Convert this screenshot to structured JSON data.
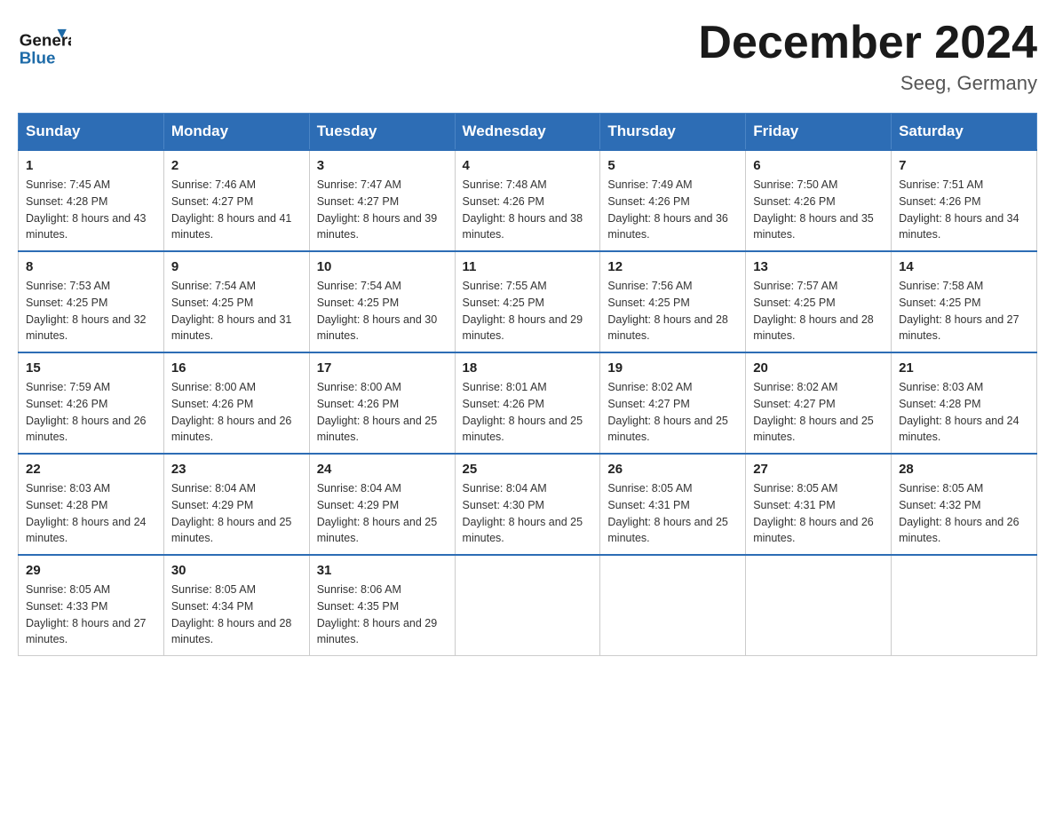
{
  "header": {
    "logo_general": "General",
    "logo_blue": "Blue",
    "title": "December 2024",
    "location": "Seeg, Germany"
  },
  "calendar": {
    "days_of_week": [
      "Sunday",
      "Monday",
      "Tuesday",
      "Wednesday",
      "Thursday",
      "Friday",
      "Saturday"
    ],
    "weeks": [
      [
        {
          "day": "1",
          "sunrise": "7:45 AM",
          "sunset": "4:28 PM",
          "daylight": "8 hours and 43 minutes."
        },
        {
          "day": "2",
          "sunrise": "7:46 AM",
          "sunset": "4:27 PM",
          "daylight": "8 hours and 41 minutes."
        },
        {
          "day": "3",
          "sunrise": "7:47 AM",
          "sunset": "4:27 PM",
          "daylight": "8 hours and 39 minutes."
        },
        {
          "day": "4",
          "sunrise": "7:48 AM",
          "sunset": "4:26 PM",
          "daylight": "8 hours and 38 minutes."
        },
        {
          "day": "5",
          "sunrise": "7:49 AM",
          "sunset": "4:26 PM",
          "daylight": "8 hours and 36 minutes."
        },
        {
          "day": "6",
          "sunrise": "7:50 AM",
          "sunset": "4:26 PM",
          "daylight": "8 hours and 35 minutes."
        },
        {
          "day": "7",
          "sunrise": "7:51 AM",
          "sunset": "4:26 PM",
          "daylight": "8 hours and 34 minutes."
        }
      ],
      [
        {
          "day": "8",
          "sunrise": "7:53 AM",
          "sunset": "4:25 PM",
          "daylight": "8 hours and 32 minutes."
        },
        {
          "day": "9",
          "sunrise": "7:54 AM",
          "sunset": "4:25 PM",
          "daylight": "8 hours and 31 minutes."
        },
        {
          "day": "10",
          "sunrise": "7:54 AM",
          "sunset": "4:25 PM",
          "daylight": "8 hours and 30 minutes."
        },
        {
          "day": "11",
          "sunrise": "7:55 AM",
          "sunset": "4:25 PM",
          "daylight": "8 hours and 29 minutes."
        },
        {
          "day": "12",
          "sunrise": "7:56 AM",
          "sunset": "4:25 PM",
          "daylight": "8 hours and 28 minutes."
        },
        {
          "day": "13",
          "sunrise": "7:57 AM",
          "sunset": "4:25 PM",
          "daylight": "8 hours and 28 minutes."
        },
        {
          "day": "14",
          "sunrise": "7:58 AM",
          "sunset": "4:25 PM",
          "daylight": "8 hours and 27 minutes."
        }
      ],
      [
        {
          "day": "15",
          "sunrise": "7:59 AM",
          "sunset": "4:26 PM",
          "daylight": "8 hours and 26 minutes."
        },
        {
          "day": "16",
          "sunrise": "8:00 AM",
          "sunset": "4:26 PM",
          "daylight": "8 hours and 26 minutes."
        },
        {
          "day": "17",
          "sunrise": "8:00 AM",
          "sunset": "4:26 PM",
          "daylight": "8 hours and 25 minutes."
        },
        {
          "day": "18",
          "sunrise": "8:01 AM",
          "sunset": "4:26 PM",
          "daylight": "8 hours and 25 minutes."
        },
        {
          "day": "19",
          "sunrise": "8:02 AM",
          "sunset": "4:27 PM",
          "daylight": "8 hours and 25 minutes."
        },
        {
          "day": "20",
          "sunrise": "8:02 AM",
          "sunset": "4:27 PM",
          "daylight": "8 hours and 25 minutes."
        },
        {
          "day": "21",
          "sunrise": "8:03 AM",
          "sunset": "4:28 PM",
          "daylight": "8 hours and 24 minutes."
        }
      ],
      [
        {
          "day": "22",
          "sunrise": "8:03 AM",
          "sunset": "4:28 PM",
          "daylight": "8 hours and 24 minutes."
        },
        {
          "day": "23",
          "sunrise": "8:04 AM",
          "sunset": "4:29 PM",
          "daylight": "8 hours and 25 minutes."
        },
        {
          "day": "24",
          "sunrise": "8:04 AM",
          "sunset": "4:29 PM",
          "daylight": "8 hours and 25 minutes."
        },
        {
          "day": "25",
          "sunrise": "8:04 AM",
          "sunset": "4:30 PM",
          "daylight": "8 hours and 25 minutes."
        },
        {
          "day": "26",
          "sunrise": "8:05 AM",
          "sunset": "4:31 PM",
          "daylight": "8 hours and 25 minutes."
        },
        {
          "day": "27",
          "sunrise": "8:05 AM",
          "sunset": "4:31 PM",
          "daylight": "8 hours and 26 minutes."
        },
        {
          "day": "28",
          "sunrise": "8:05 AM",
          "sunset": "4:32 PM",
          "daylight": "8 hours and 26 minutes."
        }
      ],
      [
        {
          "day": "29",
          "sunrise": "8:05 AM",
          "sunset": "4:33 PM",
          "daylight": "8 hours and 27 minutes."
        },
        {
          "day": "30",
          "sunrise": "8:05 AM",
          "sunset": "4:34 PM",
          "daylight": "8 hours and 28 minutes."
        },
        {
          "day": "31",
          "sunrise": "8:06 AM",
          "sunset": "4:35 PM",
          "daylight": "8 hours and 29 minutes."
        },
        null,
        null,
        null,
        null
      ]
    ]
  }
}
